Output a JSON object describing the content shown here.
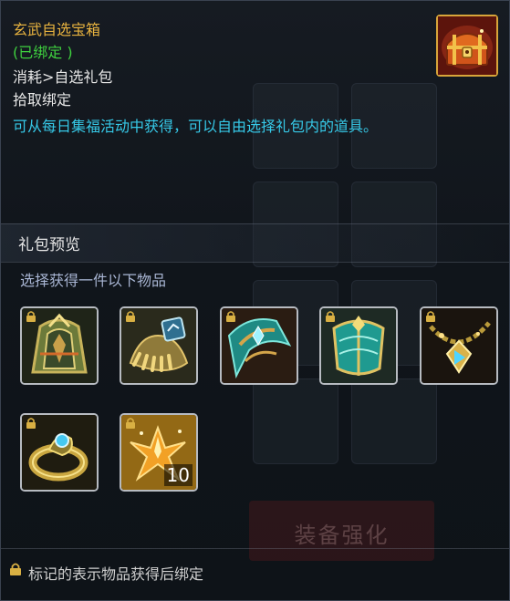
{
  "item": {
    "name": "玄武自选宝箱",
    "bind_status": "(已绑定 )",
    "category": "消耗>自选礼包",
    "pickup_rule": "拾取绑定",
    "description": "可从每日集福活动中获得，可以自由选择礼包内的道具。",
    "icon": "treasure-chest-icon"
  },
  "preview": {
    "header": "礼包预览",
    "instruction": "选择获得一件以下物品",
    "items": [
      {
        "icon": "armor-pauldron-icon",
        "locked": true,
        "quantity": ""
      },
      {
        "icon": "gauntlet-icon",
        "locked": true,
        "quantity": ""
      },
      {
        "icon": "jade-shoulder-icon",
        "locked": true,
        "quantity": ""
      },
      {
        "icon": "jade-chestplate-icon",
        "locked": true,
        "quantity": ""
      },
      {
        "icon": "amulet-necklace-icon",
        "locked": true,
        "quantity": ""
      },
      {
        "icon": "gold-ring-icon",
        "locked": true,
        "quantity": ""
      },
      {
        "icon": "amber-crystal-icon",
        "locked": true,
        "quantity": "10"
      }
    ]
  },
  "background": {
    "button_label": "装备强化"
  },
  "footer": {
    "note": "标记的表示物品获得后绑定"
  },
  "colors": {
    "title": "#e7b23f",
    "bound": "#3fd13f",
    "description": "#36c9e8",
    "instruction": "#a9b6d4"
  }
}
